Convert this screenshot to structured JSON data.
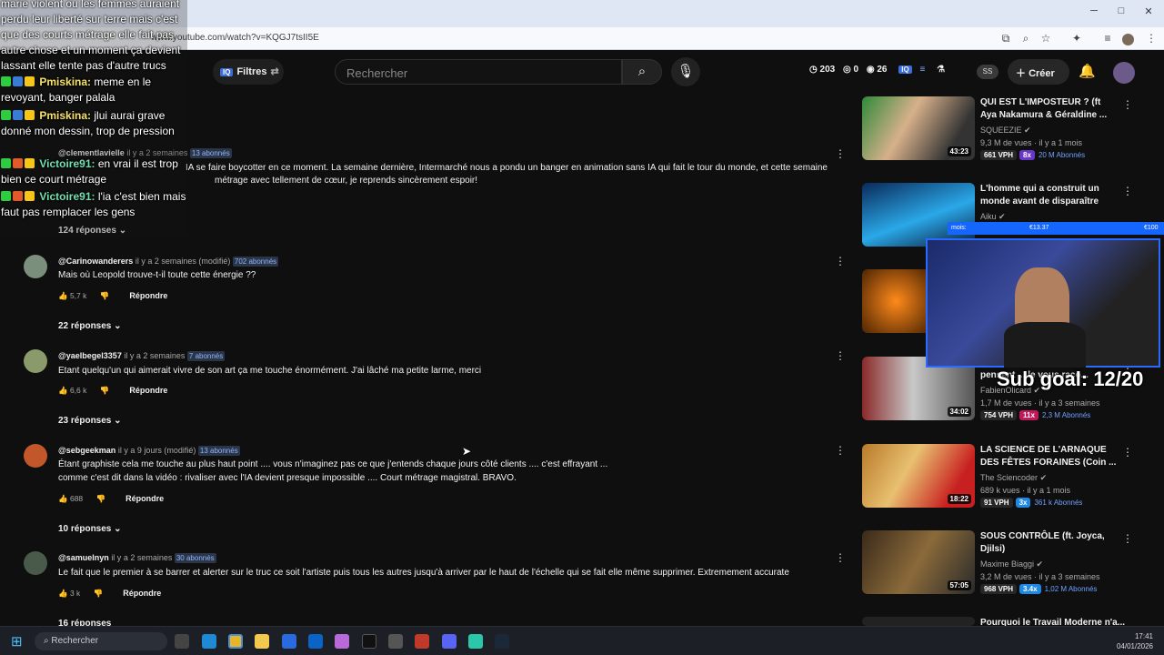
{
  "browser": {
    "url": "www.youtube.com/watch?v=KQGJ7tsII5E",
    "window_controls": [
      "─",
      "□",
      "✕"
    ]
  },
  "topbar": {
    "filters_label": "Filtres",
    "search_placeholder": "Rechercher",
    "stat_clock": "203",
    "stat_zero": "0",
    "stat_eye": "26",
    "ss_label": "SS",
    "create_label": "Créer"
  },
  "chat": {
    "messages": [
      {
        "text": "marie violent ou les femmes auraient perdu leur liberté sur terre mais c'est que des courts métrage elle fait pas autre chose et un moment ça devient lassant elle tente pas d'autre trucs"
      },
      {
        "user": "Pmiskina:",
        "text": "meme en le revoyant, banger palala"
      },
      {
        "user": "Pmiskina:",
        "text": "jlui aurai grave donné mon dessin, trop de pression"
      },
      {
        "user": "Victoire91:",
        "text": "en vrai il est trop bien ce court métrage"
      },
      {
        "user": "Victoire91:",
        "text": "l'ia c'est bien mais faut pas remplacer les gens"
      }
    ]
  },
  "comments": [
    {
      "user": "@clementlavielle",
      "time": "il y a 2 semaines",
      "subs": "13 abonnés",
      "subs_suffix": "abonnés",
      "text_l1": "IA se faire boycotter en ce moment. La semaine dernière, Intermarché nous a pondu un banger en animation sans IA qui fait le tour du monde, et cette semaine",
      "text_l2": "métrage avec tellement de cœur, je reprends sincèrement espoir!",
      "replies": "124 réponses"
    },
    {
      "user": "@Carinowanderers",
      "time": "il y a 2 semaines (modifié)",
      "subs": "702 abonnés",
      "subs_suffix": "abonnés",
      "text_l1": "Mais où Leopold trouve-t-il toute cette énergie ??",
      "likes": "5,7 k",
      "reply_label": "Répondre",
      "replies": "22 réponses"
    },
    {
      "user": "@yaelbegel3357",
      "time": "il y a 2 semaines",
      "subs": "7 abonnés",
      "subs_suffix": "abonnés",
      "text_l1": "Etant quelqu'un qui aimerait vivre de son art ça me touche énormément. J'ai lâché ma petite larme, merci",
      "likes": "6,6 k",
      "reply_label": "Répondre",
      "replies": "23 réponses"
    },
    {
      "user": "@sebgeekman",
      "time": "il y a 9 jours (modifié)",
      "subs": "13 abonnés",
      "subs_suffix": "abonnés",
      "text_l1": "Étant graphiste cela me touche au plus haut point .... vous n'imaginez pas ce que j'entends chaque jours côté clients .... c'est effrayant ...",
      "text_l2": "comme c'est dit dans la vidéo : rivaliser avec l'IA devient presque impossible .... Court métrage magistral. BRAVO.",
      "likes": "688",
      "reply_label": "Répondre",
      "replies": "10 réponses"
    },
    {
      "user": "@samuelnyn",
      "time": "il y a 2 semaines",
      "subs": "30 abonnés",
      "subs_suffix": "abonnés",
      "text_l1": "Le fait que le premier à se barrer et alerter sur le truc ce soit l'artiste puis tous les autres jusqu'à arriver par le haut de l'échelle qui se fait elle même supprimer. Extremement accurate",
      "likes": "3 k",
      "reply_label": "Répondre",
      "replies": "16 réponses"
    }
  ],
  "videos": [
    {
      "title": "QUI EST L'IMPOSTEUR ? (ft Aya Nakamura & Géraldine ...",
      "channel": "SQUEEZIE",
      "meta": "9,3 M de vues · il y a 1 mois",
      "duration": "43:23",
      "vph": "661 VPH",
      "mult": "8x",
      "mult_color": "#6a35c9",
      "subs": "20 M Abonnés"
    },
    {
      "title": "L'homme qui a construit un monde avant de disparaître",
      "channel": "Aiku",
      "duration": "",
      "vph": "",
      "mult": "",
      "mult_color": "#000000",
      "subs": ""
    },
    {
      "title": "",
      "channel": "",
      "duration": "",
      "vph": "",
      "mult": "",
      "mult_color": "#000000",
      "subs": ""
    },
    {
      "title": "pensent ... le vous raco...",
      "channel": "FabienOlicard",
      "meta": "1,7 M de vues · il y a 3 semaines",
      "duration": "34:02",
      "vph": "754 VPH",
      "mult": "11x",
      "mult_color": "#c2185b",
      "subs": "2,3 M Abonnés"
    },
    {
      "title": "LA SCIENCE DE L'ARNAQUE DES FÊTES FORAINES (Coin ...",
      "channel": "The Sciencoder",
      "meta": "689 k vues · il y a 1 mois",
      "duration": "18:22",
      "vph": "91 VPH",
      "mult": "3x",
      "mult_color": "#1e88e5",
      "subs": "361 k Abonnés"
    },
    {
      "title": "SOUS CONTRÔLE (ft. Joyca, Djilsi)",
      "channel": "Maxime Biaggi",
      "meta": "3,2 M de vues · il y a 3 semaines",
      "duration": "57:05",
      "vph": "968 VPH",
      "mult": "3.4x",
      "mult_color": "#1e88e5",
      "subs": "1,02 M Abonnés"
    },
    {
      "title": "Pourquoi le Travail Moderne n'a...",
      "channel": "",
      "duration": "",
      "vph": "",
      "mult": "",
      "mult_color": "#000000",
      "subs": ""
    }
  ],
  "overlay": {
    "sub_goal": "Sub goal: 12/20",
    "donation_left": "mois:",
    "donation_mid": "€13.37",
    "donation_right": "€100"
  },
  "taskbar": {
    "search_placeholder": "Rechercher",
    "time": "17:41",
    "date": "04/01/2026"
  },
  "colors": {
    "accent_blue": "#3ea6ff",
    "bg": "#0f0f0f"
  }
}
